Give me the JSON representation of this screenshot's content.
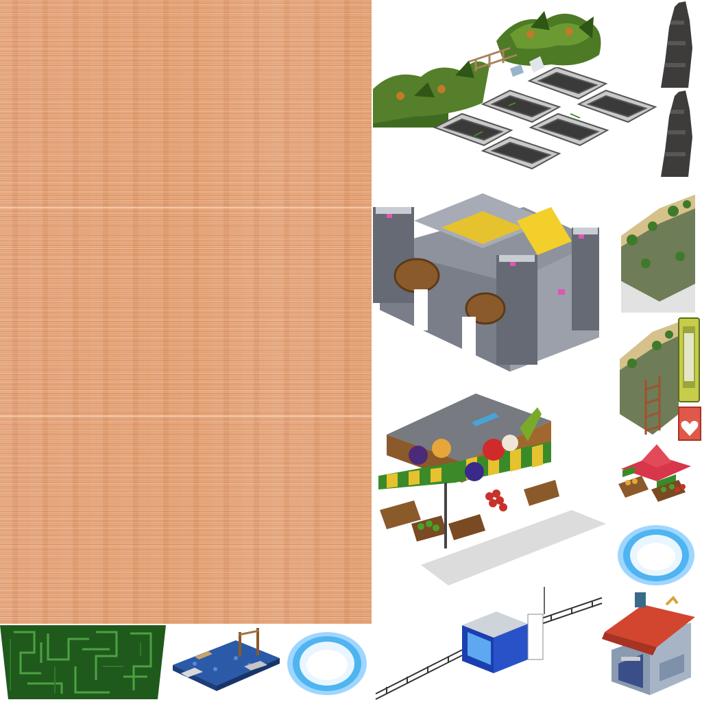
{
  "sheet": {
    "background": "#ffffff",
    "wood_color": "#e8a477"
  },
  "sprites": [
    {
      "name": "jungle-hedge-with-fence",
      "icon": "jungle-foliage-icon"
    },
    {
      "name": "stone-pillar-top",
      "icon": "stone-pillar-icon"
    },
    {
      "name": "stone-pillar-bottom",
      "icon": "stone-pillar-icon"
    },
    {
      "name": "empty-planter-pits",
      "icon": "planter-pit-icon"
    },
    {
      "name": "stone-arena-building",
      "icon": "castle-building-icon"
    },
    {
      "name": "mossy-rock-terrace",
      "icon": "mossy-rock-icon"
    },
    {
      "name": "mossy-rock-ladder",
      "icon": "rock-ladder-icon"
    },
    {
      "name": "train-car-top-view",
      "icon": "train-car-icon"
    },
    {
      "name": "heart-crate",
      "icon": "heart-icon"
    },
    {
      "name": "fruit-market-shop",
      "icon": "fruit-shop-icon"
    },
    {
      "name": "fruit-market-stall",
      "icon": "fruit-stall-icon"
    },
    {
      "name": "blue-portal-ring-large",
      "icon": "portal-ring-icon"
    },
    {
      "name": "blue-portal-ring-small",
      "icon": "portal-ring-icon"
    },
    {
      "name": "green-maze-tile",
      "icon": "maze-icon"
    },
    {
      "name": "pier-dock-platform",
      "icon": "dock-icon"
    },
    {
      "name": "blue-kiosk-with-railing",
      "icon": "kiosk-icon"
    },
    {
      "name": "red-roof-shop",
      "icon": "red-roof-house-icon"
    }
  ]
}
